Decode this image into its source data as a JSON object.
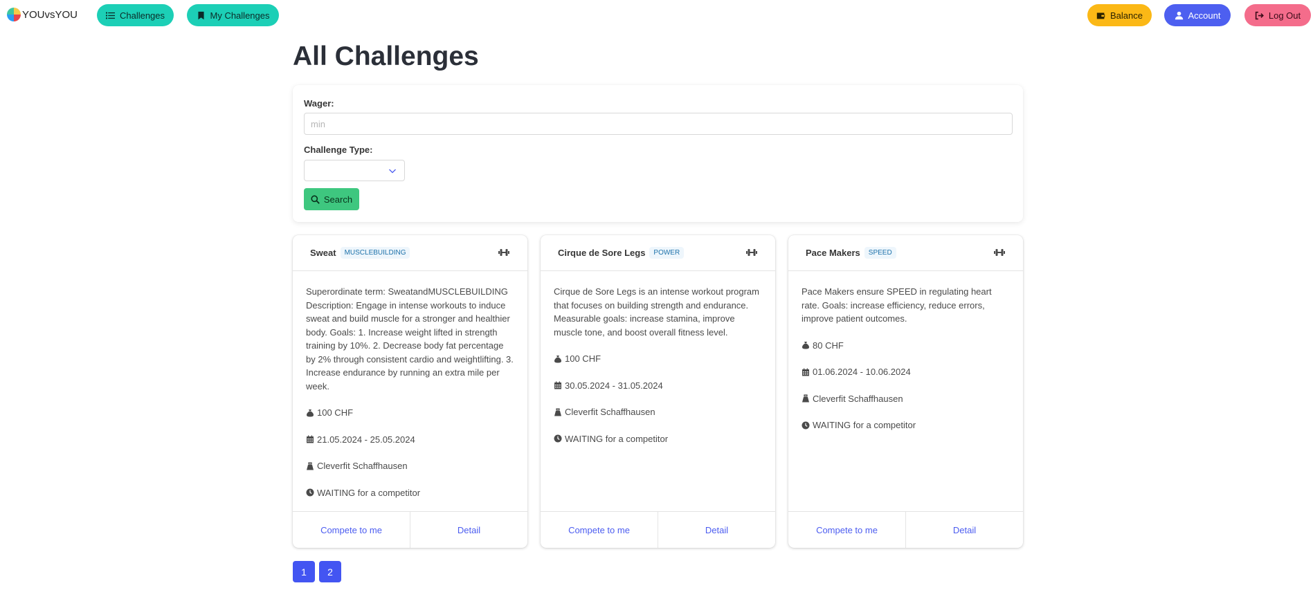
{
  "nav": {
    "brand": "YOUvsYOU",
    "challenges": "Challenges",
    "my_challenges": "My Challenges",
    "balance": "Balance",
    "account": "Account",
    "logout": "Log Out"
  },
  "page_title": "All Challenges",
  "search": {
    "wager_label": "Wager:",
    "wager_placeholder": "min",
    "type_label": "Challenge Type:",
    "type_value": "",
    "button": "Search"
  },
  "cards": [
    {
      "title": "Sweat",
      "tag": "MUSCLEBUILDING",
      "description": "Superordinate term: SweatandMUSCLEBUILDING Description: Engage in intense workouts to induce sweat and build muscle for a stronger and healthier body. Goals: 1. Increase weight lifted in strength training by 10%. 2. Decrease body fat percentage by 2% through consistent cardio and weightlifting. 3. Increase endurance by running an extra mile per week.",
      "wager": "100 CHF",
      "dates": "21.05.2024 - 25.05.2024",
      "location": "Cleverfit Schaffhausen",
      "status": "WAITING for a competitor",
      "compete": "Compete to me",
      "detail": "Detail"
    },
    {
      "title": "Cirque de Sore Legs",
      "tag": "POWER",
      "description": "Cirque de Sore Legs is an intense workout program that focuses on building strength and endurance. Measurable goals: increase stamina, improve muscle tone, and boost overall fitness level.",
      "wager": "100 CHF",
      "dates": "30.05.2024 - 31.05.2024",
      "location": "Cleverfit Schaffhausen",
      "status": "WAITING for a competitor",
      "compete": "Compete to me",
      "detail": "Detail"
    },
    {
      "title": "Pace Makers",
      "tag": "SPEED",
      "description": "Pace Makers ensure SPEED in regulating heart rate. Goals: increase efficiency, reduce errors, improve patient outcomes.",
      "wager": "80 CHF",
      "dates": "01.06.2024 - 10.06.2024",
      "location": "Cleverfit Schaffhausen",
      "status": "WAITING for a competitor",
      "compete": "Compete to me",
      "detail": "Detail"
    }
  ],
  "pagination": [
    "1",
    "2"
  ],
  "colors": {
    "nav_teal": "#1ccfb6",
    "balance": "#fbb816",
    "account": "#4d5ff0",
    "logout": "#f46c8b",
    "search_button": "#3ec77f",
    "link": "#4b5cf0",
    "pagination": "#4355f2"
  },
  "icons": {
    "challenges": "list-icon",
    "my_challenges": "bookmark-icon",
    "balance": "wallet-icon",
    "account": "user-icon",
    "logout": "sign-out-icon",
    "search": "search-icon",
    "card": "dumbbell-icon",
    "wager": "money-bag-icon",
    "dates": "calendar-icon",
    "location": "kettlebell-icon",
    "status": "clock-icon"
  }
}
